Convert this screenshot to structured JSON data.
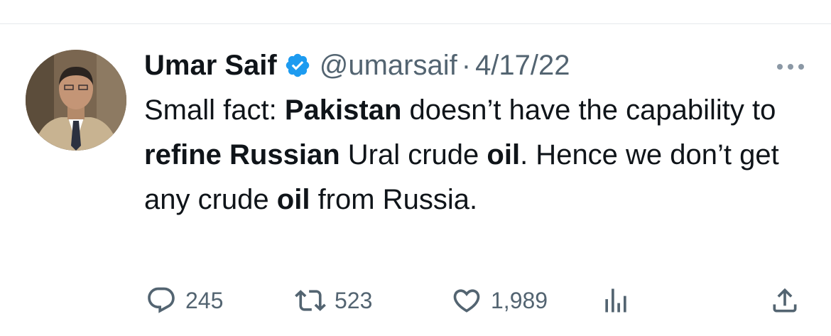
{
  "author": {
    "display_name": "Umar Saif",
    "handle": "@umarsaif",
    "separator": "·",
    "date": "4/17/22",
    "verified": true
  },
  "tweet": {
    "segments": [
      {
        "text": "Small fact: ",
        "bold": false
      },
      {
        "text": "Pakistan",
        "bold": true
      },
      {
        "text": " doesn’t have the capability to ",
        "bold": false
      },
      {
        "text": "refine Russian",
        "bold": true
      },
      {
        "text": " Ural crude ",
        "bold": false
      },
      {
        "text": "oil",
        "bold": true
      },
      {
        "text": ". Hence we don’t get any crude ",
        "bold": false
      },
      {
        "text": "oil",
        "bold": true
      },
      {
        "text": " from Russia.",
        "bold": false
      }
    ]
  },
  "actions": {
    "reply": {
      "icon": "reply-icon",
      "count": "245"
    },
    "retweet": {
      "icon": "retweet-icon",
      "count": "523"
    },
    "like": {
      "icon": "heart-icon",
      "count": "1,989"
    },
    "views": {
      "icon": "analytics-icon"
    },
    "share": {
      "icon": "share-icon"
    }
  },
  "colors": {
    "verified_blue": "#1d9bf0",
    "secondary_text": "#536471",
    "primary_text": "#0f1419"
  }
}
